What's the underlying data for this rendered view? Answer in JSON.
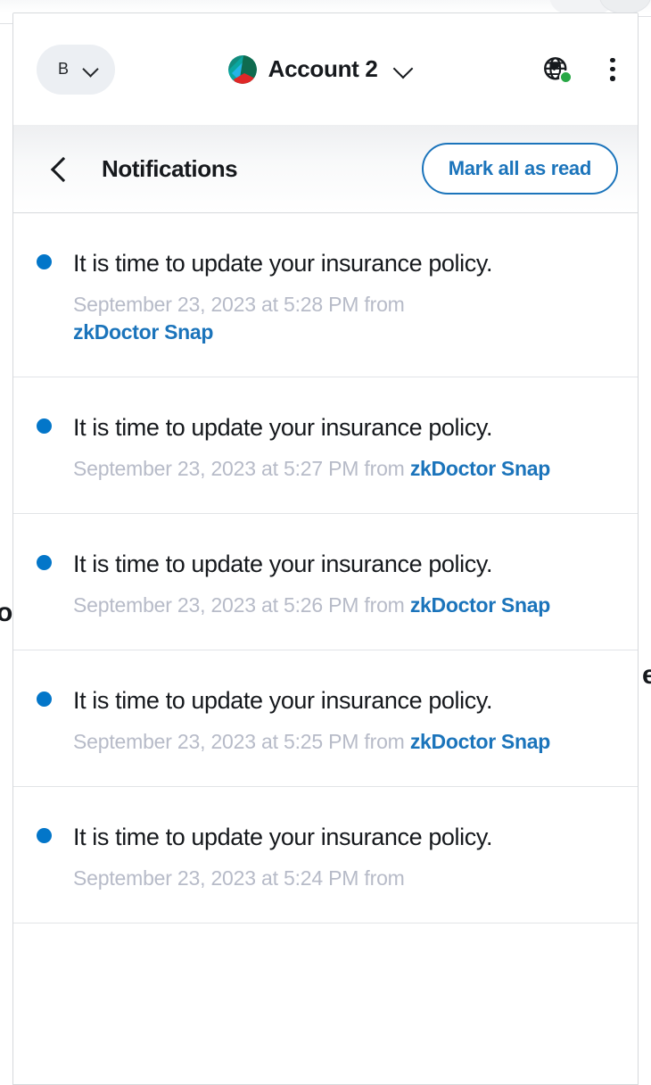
{
  "header": {
    "network_label": "B",
    "network_chevron_icon": "chevron-down-icon",
    "account_name": "Account 2",
    "account_chevron_icon": "chevron-down-icon",
    "avatar_icon": "account-avatar",
    "globe_icon": "globe-icon",
    "connection_status_color": "#28a745",
    "menu_icon": "kebab-menu-icon"
  },
  "notifications_bar": {
    "back_icon": "chevron-left-icon",
    "title": "Notifications",
    "mark_all_label": "Mark all as read",
    "accent_color": "#1b74bb"
  },
  "notifications": [
    {
      "text": "It is time to update your insurance policy.",
      "meta_prefix": "September 23, 2023 at 5:28 PM from",
      "source": "zkDoctor Snap",
      "unread": true,
      "narrow_meta": true
    },
    {
      "text": "It is time to update your insurance policy.",
      "meta_prefix": "September 23, 2023 at 5:27 PM from",
      "source": "zkDoctor Snap",
      "unread": true,
      "narrow_meta": false
    },
    {
      "text": "It is time to update your insurance policy.",
      "meta_prefix": "September 23, 2023 at 5:26 PM from",
      "source": "zkDoctor Snap",
      "unread": true,
      "narrow_meta": false
    },
    {
      "text": "It is time to update your insurance policy.",
      "meta_prefix": "September 23, 2023 at 5:25 PM from",
      "source": "zkDoctor Snap",
      "unread": true,
      "narrow_meta": false
    },
    {
      "text": "It is time to update your insurance policy.",
      "meta_prefix": "September 23, 2023 at 5:24 PM from",
      "source": "",
      "unread": true,
      "narrow_meta": false
    }
  ],
  "background": {
    "glyph_left": "o",
    "glyph_right": "e"
  },
  "colors": {
    "unread_dot": "#0376c9",
    "link": "#1b74bb",
    "meta_text": "#b7bbc8",
    "primary_text": "#16191d",
    "panel_border": "#d6d9dc",
    "pill_bg": "#eceff3"
  }
}
